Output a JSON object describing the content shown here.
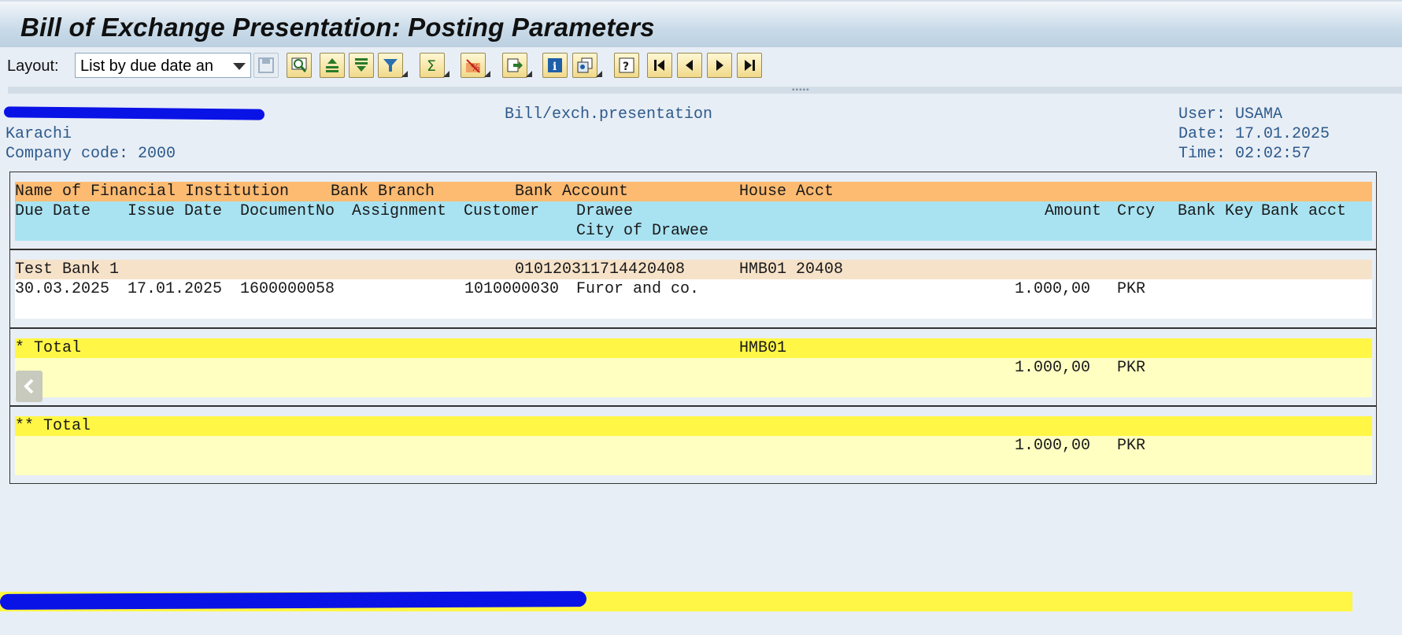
{
  "title": "Bill of Exchange Presentation: Posting Parameters",
  "toolbar": {
    "layout_label": "Layout:",
    "layout_value": "List by due date an",
    "icons": [
      "save-icon",
      "find-icon",
      "sort-ascending-icon",
      "sort-descending-icon",
      "filter-icon",
      "sum-icon",
      "subtotal-icon",
      "export-icon",
      "info-icon",
      "view-icon",
      "help-icon",
      "first-page-icon",
      "previous-page-icon",
      "next-page-icon",
      "last-page-icon"
    ]
  },
  "header": {
    "left": [
      "Karachi",
      "Company code: 2000"
    ],
    "center": "Bill/exch.presentation",
    "right": [
      "User: USAMA",
      "Date: 17.01.2025",
      "Time: 02:02:57"
    ]
  },
  "report": {
    "col_header_1": {
      "institution": "Name of Financial Institution",
      "branch": "Bank Branch",
      "account": "Bank Account",
      "house": "House Acct"
    },
    "col_header_2": {
      "due_date": "Due Date",
      "issue_date": "Issue Date",
      "document_no": "DocumentNo",
      "assignment": "Assignment",
      "customer": "Customer",
      "drawee": "Drawee",
      "amount": "Amount",
      "crcy": "Crcy",
      "bank_key": "Bank Key",
      "bank_acct": "Bank acct"
    },
    "col_header_3": {
      "city": "City of Drawee"
    },
    "group": {
      "institution": "Test Bank 1",
      "account": "010120311714420408",
      "house": "HMB01 20408"
    },
    "item": {
      "due_date": "30.03.2025",
      "issue_date": "17.01.2025",
      "document_no": "1600000058",
      "customer": "1010000030",
      "drawee": "Furor and co.",
      "amount": "1.000,00",
      "crcy": "PKR"
    },
    "subtotal": {
      "label": "* Total",
      "house": "HMB01",
      "amount": "1.000,00",
      "crcy": "PKR"
    },
    "total": {
      "label": "** Total",
      "amount": "1.000,00",
      "crcy": "PKR"
    }
  },
  "colors": {
    "orange_header": "#fdbb72",
    "cyan_header": "#a9e3f2",
    "total_yellow": "#fff645",
    "redaction": "#0a13e6"
  }
}
